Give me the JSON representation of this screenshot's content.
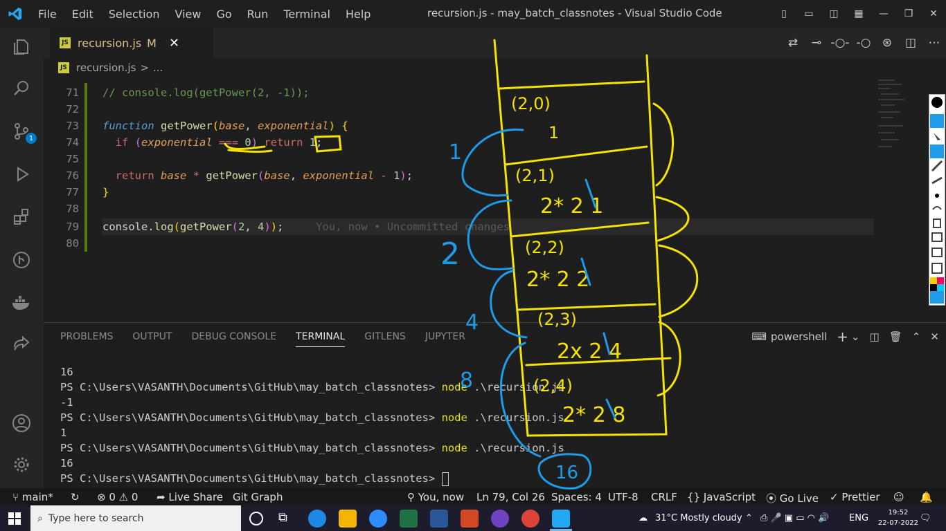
{
  "titlebar": {
    "menu": [
      "File",
      "Edit",
      "Selection",
      "View",
      "Go",
      "Run",
      "Terminal",
      "Help"
    ],
    "window_title": "recursion.js - may_batch_classnotes - Visual Studio Code"
  },
  "tab": {
    "name": "recursion.js",
    "modified": "M",
    "close": "✕"
  },
  "breadcrumb": {
    "file": "recursion.js",
    "sep": ">",
    "rest": "..."
  },
  "scm_badge": "1",
  "editor": {
    "lines": [
      {
        "no": "71"
      },
      {
        "no": "72"
      },
      {
        "no": "73"
      },
      {
        "no": "74"
      },
      {
        "no": "75"
      },
      {
        "no": "76"
      },
      {
        "no": "77"
      },
      {
        "no": "78"
      },
      {
        "no": "79"
      },
      {
        "no": "80"
      }
    ],
    "blame": "You, now • Uncommitted changes"
  },
  "panel": {
    "tabs": [
      "PROBLEMS",
      "OUTPUT",
      "DEBUG CONSOLE",
      "TERMINAL",
      "GITLENS",
      "JUPYTER"
    ],
    "active_tab": "TERMINAL",
    "shell": "powershell",
    "terminal_lines": [
      "16",
      "PS C:\\Users\\VASANTH\\Documents\\GitHub\\may_batch_classnotes> node .\\recursion.js",
      "-1",
      "PS C:\\Users\\VASANTH\\Documents\\GitHub\\may_batch_classnotes> node .\\recursion.js",
      "1",
      "PS C:\\Users\\VASANTH\\Documents\\GitHub\\may_batch_classnotes> node .\\recursion.js",
      "16",
      "PS C:\\Users\\VASANTH\\Documents\\GitHub\\may_batch_classnotes> "
    ]
  },
  "statusbar": {
    "branch": "main*",
    "problems": "⊗ 0 ⚠ 0",
    "live_share": "Live Share",
    "git_graph": "Git Graph",
    "blame": "You, now",
    "position": "Ln 79, Col 26",
    "spaces": "Spaces: 4",
    "encoding": "UTF-8",
    "eol": "CRLF",
    "language": "{} JavaScript",
    "go_live": "Go Live",
    "prettier": "Prettier"
  },
  "taskbar": {
    "search_placeholder": "Type here to search",
    "weather": "31°C  Mostly cloudy",
    "lang": "ENG",
    "time": "19:52",
    "date": "22-07-2022"
  },
  "annotations": {
    "frames": [
      "(2,0)",
      "(2,1)",
      "(2,2)",
      "(2,3)",
      "(2,4)"
    ],
    "frame_values": [
      "1",
      "2* 2 1",
      "2* 2 2",
      "2x 2 4",
      "2* 2 8"
    ],
    "left_numbers": [
      "1",
      "2",
      "4",
      "8"
    ],
    "result": "16"
  },
  "colors": {
    "accent": "#007acc",
    "ink_yellow": "#f5e400",
    "ink_blue": "#1e9be9"
  }
}
